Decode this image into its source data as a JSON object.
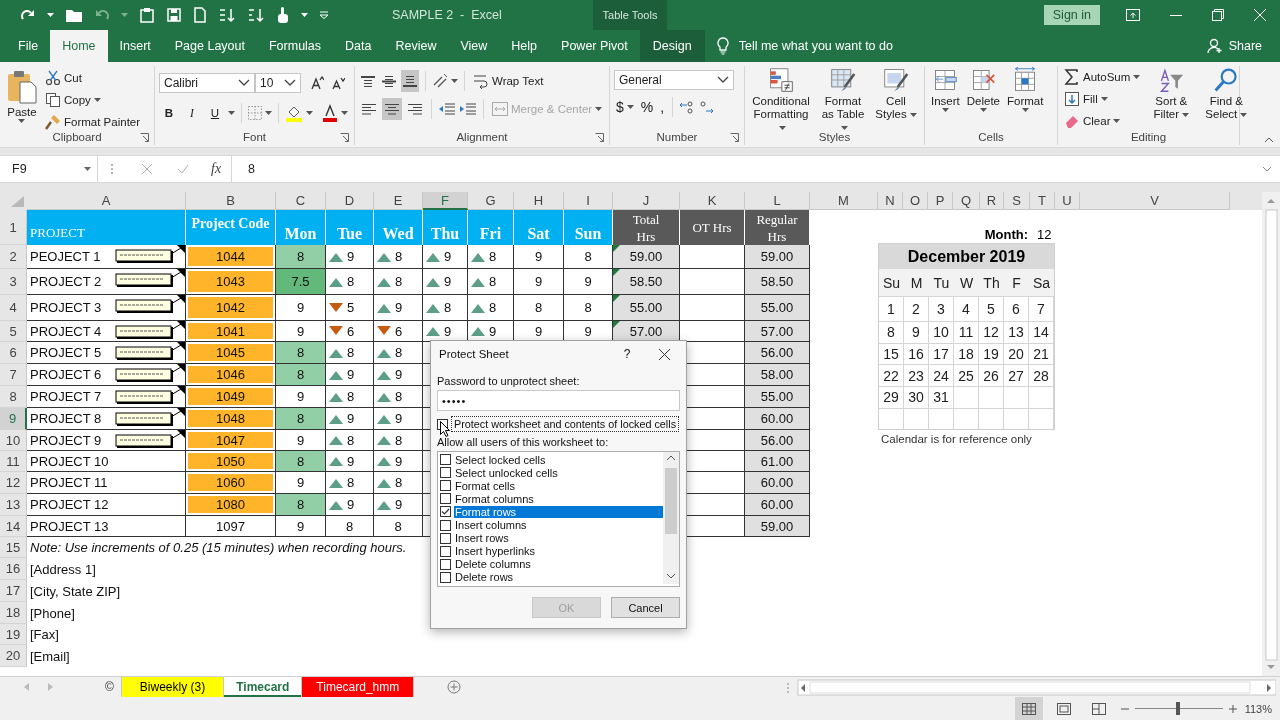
{
  "title_bar": {
    "title": "SAMPLE 2  -  Excel",
    "context_label": "Table Tools",
    "sign_in": "Sign in"
  },
  "tabs": [
    {
      "label": "File",
      "selected": false,
      "kind": "normal"
    },
    {
      "label": "Home",
      "selected": true,
      "kind": "normal"
    },
    {
      "label": "Insert",
      "selected": false,
      "kind": "normal"
    },
    {
      "label": "Page Layout",
      "selected": false,
      "kind": "normal"
    },
    {
      "label": "Formulas",
      "selected": false,
      "kind": "normal"
    },
    {
      "label": "Data",
      "selected": false,
      "kind": "normal"
    },
    {
      "label": "Review",
      "selected": false,
      "kind": "normal"
    },
    {
      "label": "View",
      "selected": false,
      "kind": "normal"
    },
    {
      "label": "Help",
      "selected": false,
      "kind": "normal"
    },
    {
      "label": "Power Pivot",
      "selected": false,
      "kind": "normal"
    },
    {
      "label": "Design",
      "selected": false,
      "kind": "contextual"
    }
  ],
  "tell_me": "Tell me what you want to do",
  "share": "Share",
  "ribbon": {
    "clipboard": {
      "label": "Clipboard",
      "paste": "Paste",
      "commands": [
        "Cut",
        "Copy",
        "Format Painter"
      ]
    },
    "font": {
      "label": "Font",
      "font_name": "Calibri",
      "font_size": "10",
      "styles": [
        "B",
        "I",
        "U"
      ]
    },
    "alignment": {
      "label": "Alignment",
      "wrap_text": "Wrap Text",
      "merge": {
        "label": "Merge & Center",
        "disabled": true
      },
      "vertical_buttons": [
        {
          "kind": "top",
          "selected": false
        },
        {
          "kind": "middle",
          "selected": false
        },
        {
          "kind": "bottom",
          "selected": true
        }
      ],
      "horizontal_buttons": [
        {
          "kind": "left",
          "selected": false
        },
        {
          "kind": "center",
          "selected": true
        },
        {
          "kind": "right",
          "selected": false
        }
      ]
    },
    "number": {
      "label": "Number",
      "format": "General",
      "symbols": [
        "$",
        "%",
        ","
      ]
    },
    "styles": {
      "label": "Styles",
      "commands": [
        "Conditional Formatting",
        "Format as Table",
        "Cell Styles"
      ]
    },
    "cells": {
      "label": "Cells",
      "commands": [
        "Insert",
        "Delete",
        "Format"
      ]
    },
    "editing": {
      "label": "Editing",
      "commands": [
        "AutoSum",
        "Fill",
        "Clear"
      ],
      "large": [
        "Sort & Filter",
        "Find & Select"
      ]
    }
  },
  "formula_bar": {
    "name_box": "F9",
    "function_label": "fx",
    "value": "8"
  },
  "sheet": {
    "columns": [
      {
        "label": "A",
        "selected": false
      },
      {
        "label": "B",
        "selected": false
      },
      {
        "label": "C",
        "selected": false
      },
      {
        "label": "D",
        "selected": false
      },
      {
        "label": "E",
        "selected": false
      },
      {
        "label": "F",
        "selected": true
      },
      {
        "label": "G",
        "selected": false
      },
      {
        "label": "H",
        "selected": false
      },
      {
        "label": "I",
        "selected": false
      },
      {
        "label": "J",
        "selected": false
      },
      {
        "label": "K",
        "selected": false
      },
      {
        "label": "L",
        "selected": false
      },
      {
        "label": "M",
        "selected": false
      },
      {
        "label": "N",
        "selected": false
      },
      {
        "label": "O",
        "selected": false
      },
      {
        "label": "P",
        "selected": false
      },
      {
        "label": "Q",
        "selected": false
      },
      {
        "label": "R",
        "selected": false
      },
      {
        "label": "S",
        "selected": false
      },
      {
        "label": "T",
        "selected": false
      },
      {
        "label": "U",
        "selected": false
      },
      {
        "label": "V",
        "selected": false
      }
    ],
    "rows": [
      {
        "label": "1",
        "selected": false
      },
      {
        "label": "2",
        "selected": false
      },
      {
        "label": "3",
        "selected": false
      },
      {
        "label": "4",
        "selected": false
      },
      {
        "label": "5",
        "selected": false
      },
      {
        "label": "6",
        "selected": false
      },
      {
        "label": "7",
        "selected": false
      },
      {
        "label": "8",
        "selected": false
      },
      {
        "label": "9",
        "selected": true
      },
      {
        "label": "10",
        "selected": false
      },
      {
        "label": "11",
        "selected": false
      },
      {
        "label": "12",
        "selected": false
      },
      {
        "label": "13",
        "selected": false
      },
      {
        "label": "14",
        "selected": false
      },
      {
        "label": "15",
        "selected": false
      },
      {
        "label": "16",
        "selected": false
      },
      {
        "label": "17",
        "selected": false
      },
      {
        "label": "18",
        "selected": false
      },
      {
        "label": "19",
        "selected": false
      },
      {
        "label": "20",
        "selected": false
      }
    ],
    "header": {
      "project": "PROJECT",
      "code": "Project Code",
      "days": [
        "Mon",
        "Tue",
        "Wed",
        "Thu",
        "Fri",
        "Sat",
        "Sun"
      ],
      "total": "Total Hrs",
      "ot": "OT Hrs",
      "regular": "Regular Hrs"
    },
    "data": [
      {
        "project": "PEOJECT 1",
        "comment": true,
        "code": "1044",
        "code_flag": true,
        "mon": {
          "value": "8",
          "color": "#93cfa6"
        },
        "days": [
          {
            "value": "9",
            "kind": "up"
          },
          {
            "value": "8",
            "kind": "up"
          },
          {
            "value": "9",
            "kind": "up"
          },
          {
            "value": "8",
            "kind": "up"
          },
          {
            "value": "9",
            "kind": "plain"
          },
          {
            "value": "8",
            "kind": "plain"
          }
        ],
        "total": "59.00",
        "regular": "59.00"
      },
      {
        "project": "PROJECT 2",
        "comment": true,
        "code": "1043",
        "code_flag": true,
        "mon": {
          "value": "7.5",
          "color": "#63b97c"
        },
        "days": [
          {
            "value": "8",
            "kind": "up"
          },
          {
            "value": "8",
            "kind": "up"
          },
          {
            "value": "9",
            "kind": "up"
          },
          {
            "value": "8",
            "kind": "up"
          },
          {
            "value": "9",
            "kind": "plain"
          },
          {
            "value": "9",
            "kind": "plain"
          }
        ],
        "total": "58.50",
        "regular": "58.50"
      },
      {
        "project": "PROJECT 3",
        "comment": true,
        "code": "1042",
        "code_flag": true,
        "mon": {
          "value": "9"
        },
        "days": [
          {
            "value": "5",
            "kind": "down"
          },
          {
            "value": "9",
            "kind": "up"
          },
          {
            "value": "8",
            "kind": "up"
          },
          {
            "value": "8",
            "kind": "up"
          },
          {
            "value": "8",
            "kind": "plain"
          },
          {
            "value": "8",
            "kind": "plain"
          }
        ],
        "total": "55.00",
        "regular": "55.00"
      },
      {
        "project": "PROJECT 4",
        "comment": true,
        "code": "1041",
        "code_flag": true,
        "mon": {
          "value": "9"
        },
        "days": [
          {
            "value": "6",
            "kind": "down"
          },
          {
            "value": "6",
            "kind": "down"
          },
          {
            "value": "9",
            "kind": "up"
          },
          {
            "value": "9",
            "kind": "up"
          },
          {
            "value": "9",
            "kind": "plain"
          },
          {
            "value": "9",
            "kind": "plain"
          }
        ],
        "total": "57.00",
        "regular": "57.00"
      },
      {
        "project": "PROJECT 5",
        "comment": true,
        "code": "1045",
        "code_flag": true,
        "mon": {
          "value": "8",
          "color": "#93cfa6"
        },
        "days": [
          {
            "value": "8",
            "kind": "up"
          },
          {
            "value": "8",
            "kind": "up"
          }
        ],
        "regular": "56.00"
      },
      {
        "project": "PROJECT 6",
        "comment": true,
        "code": "1046",
        "code_flag": true,
        "mon": {
          "value": "8",
          "color": "#93cfa6"
        },
        "days": [
          {
            "value": "9",
            "kind": "up"
          },
          {
            "value": "9",
            "kind": "up"
          }
        ],
        "regular": "58.00"
      },
      {
        "project": "PROJECT 7",
        "comment": true,
        "code": "1049",
        "code_flag": true,
        "mon": {
          "value": "9"
        },
        "days": [
          {
            "value": "8",
            "kind": "up"
          },
          {
            "value": "8",
            "kind": "up"
          }
        ],
        "regular": "55.00"
      },
      {
        "project": "PROJECT 8",
        "comment": true,
        "code": "1048",
        "code_flag": true,
        "mon": {
          "value": "8",
          "color": "#93cfa6"
        },
        "days": [
          {
            "value": "9",
            "kind": "up"
          },
          {
            "value": "9",
            "kind": "up"
          }
        ],
        "regular": "60.00"
      },
      {
        "project": "PROJECT 9",
        "comment": true,
        "code": "1047",
        "code_flag": true,
        "mon": {
          "value": "9"
        },
        "days": [
          {
            "value": "8",
            "kind": "up"
          },
          {
            "value": "8",
            "kind": "up"
          }
        ],
        "regular": "56.00"
      },
      {
        "project": "PROJECT 10",
        "comment": false,
        "code": "1050",
        "code_flag": true,
        "mon": {
          "value": "8",
          "color": "#93cfa6"
        },
        "days": [
          {
            "value": "9",
            "kind": "up"
          },
          {
            "value": "9",
            "kind": "up"
          }
        ],
        "regular": "61.00"
      },
      {
        "project": "PROJECT 11",
        "comment": false,
        "code": "1060",
        "code_flag": true,
        "mon": {
          "value": "9"
        },
        "days": [
          {
            "value": "8",
            "kind": "up"
          },
          {
            "value": "8",
            "kind": "up"
          }
        ],
        "regular": "60.00"
      },
      {
        "project": "PROJECT 12",
        "comment": false,
        "code": "1080",
        "code_flag": true,
        "mon": {
          "value": "8",
          "color": "#93cfa6"
        },
        "days": [
          {
            "value": "9",
            "kind": "up"
          },
          {
            "value": "9",
            "kind": "up"
          }
        ],
        "regular": "60.00"
      },
      {
        "project": "PROJECT 13",
        "comment": false,
        "code": "1097",
        "code_flag": false,
        "mon": {
          "value": "9"
        },
        "days": [
          {
            "value": "8",
            "kind": "plain"
          },
          {
            "value": "8",
            "kind": "plain"
          }
        ],
        "regular": "59.00"
      }
    ],
    "notes": [
      {
        "text": "Note: Use increments of 0.25 (15 minutes) when recording hours.",
        "kind": "note"
      },
      {
        "text": "[Address 1]",
        "kind": "plain"
      },
      {
        "text": "[City, State  ZIP]",
        "kind": "plain"
      },
      {
        "text": "[Phone]",
        "kind": "plain"
      },
      {
        "text": "[Fax]",
        "kind": "plain"
      },
      {
        "text": "[Email]",
        "kind": "plain"
      }
    ],
    "calendar": {
      "month_label": "Month:",
      "month": "12",
      "title": "December 2019",
      "weekdays": [
        "Su",
        "M",
        "Tu",
        "W",
        "Th",
        "F",
        "Sa"
      ],
      "weeks": [
        [
          "1",
          "2",
          "3",
          "4",
          "5",
          "6",
          "7"
        ],
        [
          "8",
          "9",
          "10",
          "11",
          "12",
          "13",
          "14"
        ],
        [
          "15",
          "16",
          "17",
          "18",
          "19",
          "20",
          "21"
        ],
        [
          "22",
          "23",
          "24",
          "25",
          "26",
          "27",
          "28"
        ],
        [
          "29",
          "30",
          "31"
        ]
      ],
      "note": "Calendar is for reference only"
    }
  },
  "sheet_tabs": [
    {
      "label": "©",
      "selected": false
    },
    {
      "label": "Biweekly (3)",
      "selected": false,
      "color": "#ffff00"
    },
    {
      "label": "Timecard",
      "selected": true
    },
    {
      "label": "Timecard_hmm",
      "selected": false,
      "color": "#ff0000"
    }
  ],
  "status_bar": {
    "views": [
      {
        "kind": "normal",
        "selected": true
      },
      {
        "kind": "page_layout",
        "selected": false
      },
      {
        "kind": "page_break",
        "selected": false
      }
    ],
    "zoom": {
      "level": 0.49,
      "reading": "113%"
    }
  },
  "dialog": {
    "title": "Protect Sheet",
    "help": "?",
    "password_label": "Password to unprotect sheet:",
    "password": "•••••",
    "protect": {
      "label": "Protect worksheet and contents of locked cells",
      "checked": false
    },
    "allow_label": "Allow all users of this worksheet to:",
    "options": [
      {
        "label": "Select locked cells",
        "checked": false,
        "selected": false
      },
      {
        "label": "Select unlocked cells",
        "checked": false,
        "selected": false
      },
      {
        "label": "Format cells",
        "checked": false,
        "selected": false
      },
      {
        "label": "Format columns",
        "checked": false,
        "selected": false
      },
      {
        "label": "Format rows",
        "checked": true,
        "selected": true
      },
      {
        "label": "Insert columns",
        "checked": false,
        "selected": false
      },
      {
        "label": "Insert rows",
        "checked": false,
        "selected": false
      },
      {
        "label": "Insert hyperlinks",
        "checked": false,
        "selected": false
      },
      {
        "label": "Delete columns",
        "checked": false,
        "selected": false
      },
      {
        "label": "Delete rows",
        "checked": false,
        "selected": false
      }
    ],
    "buttons": [
      {
        "label": "OK",
        "disabled": true
      },
      {
        "label": "Cancel",
        "disabled": false
      }
    ]
  }
}
